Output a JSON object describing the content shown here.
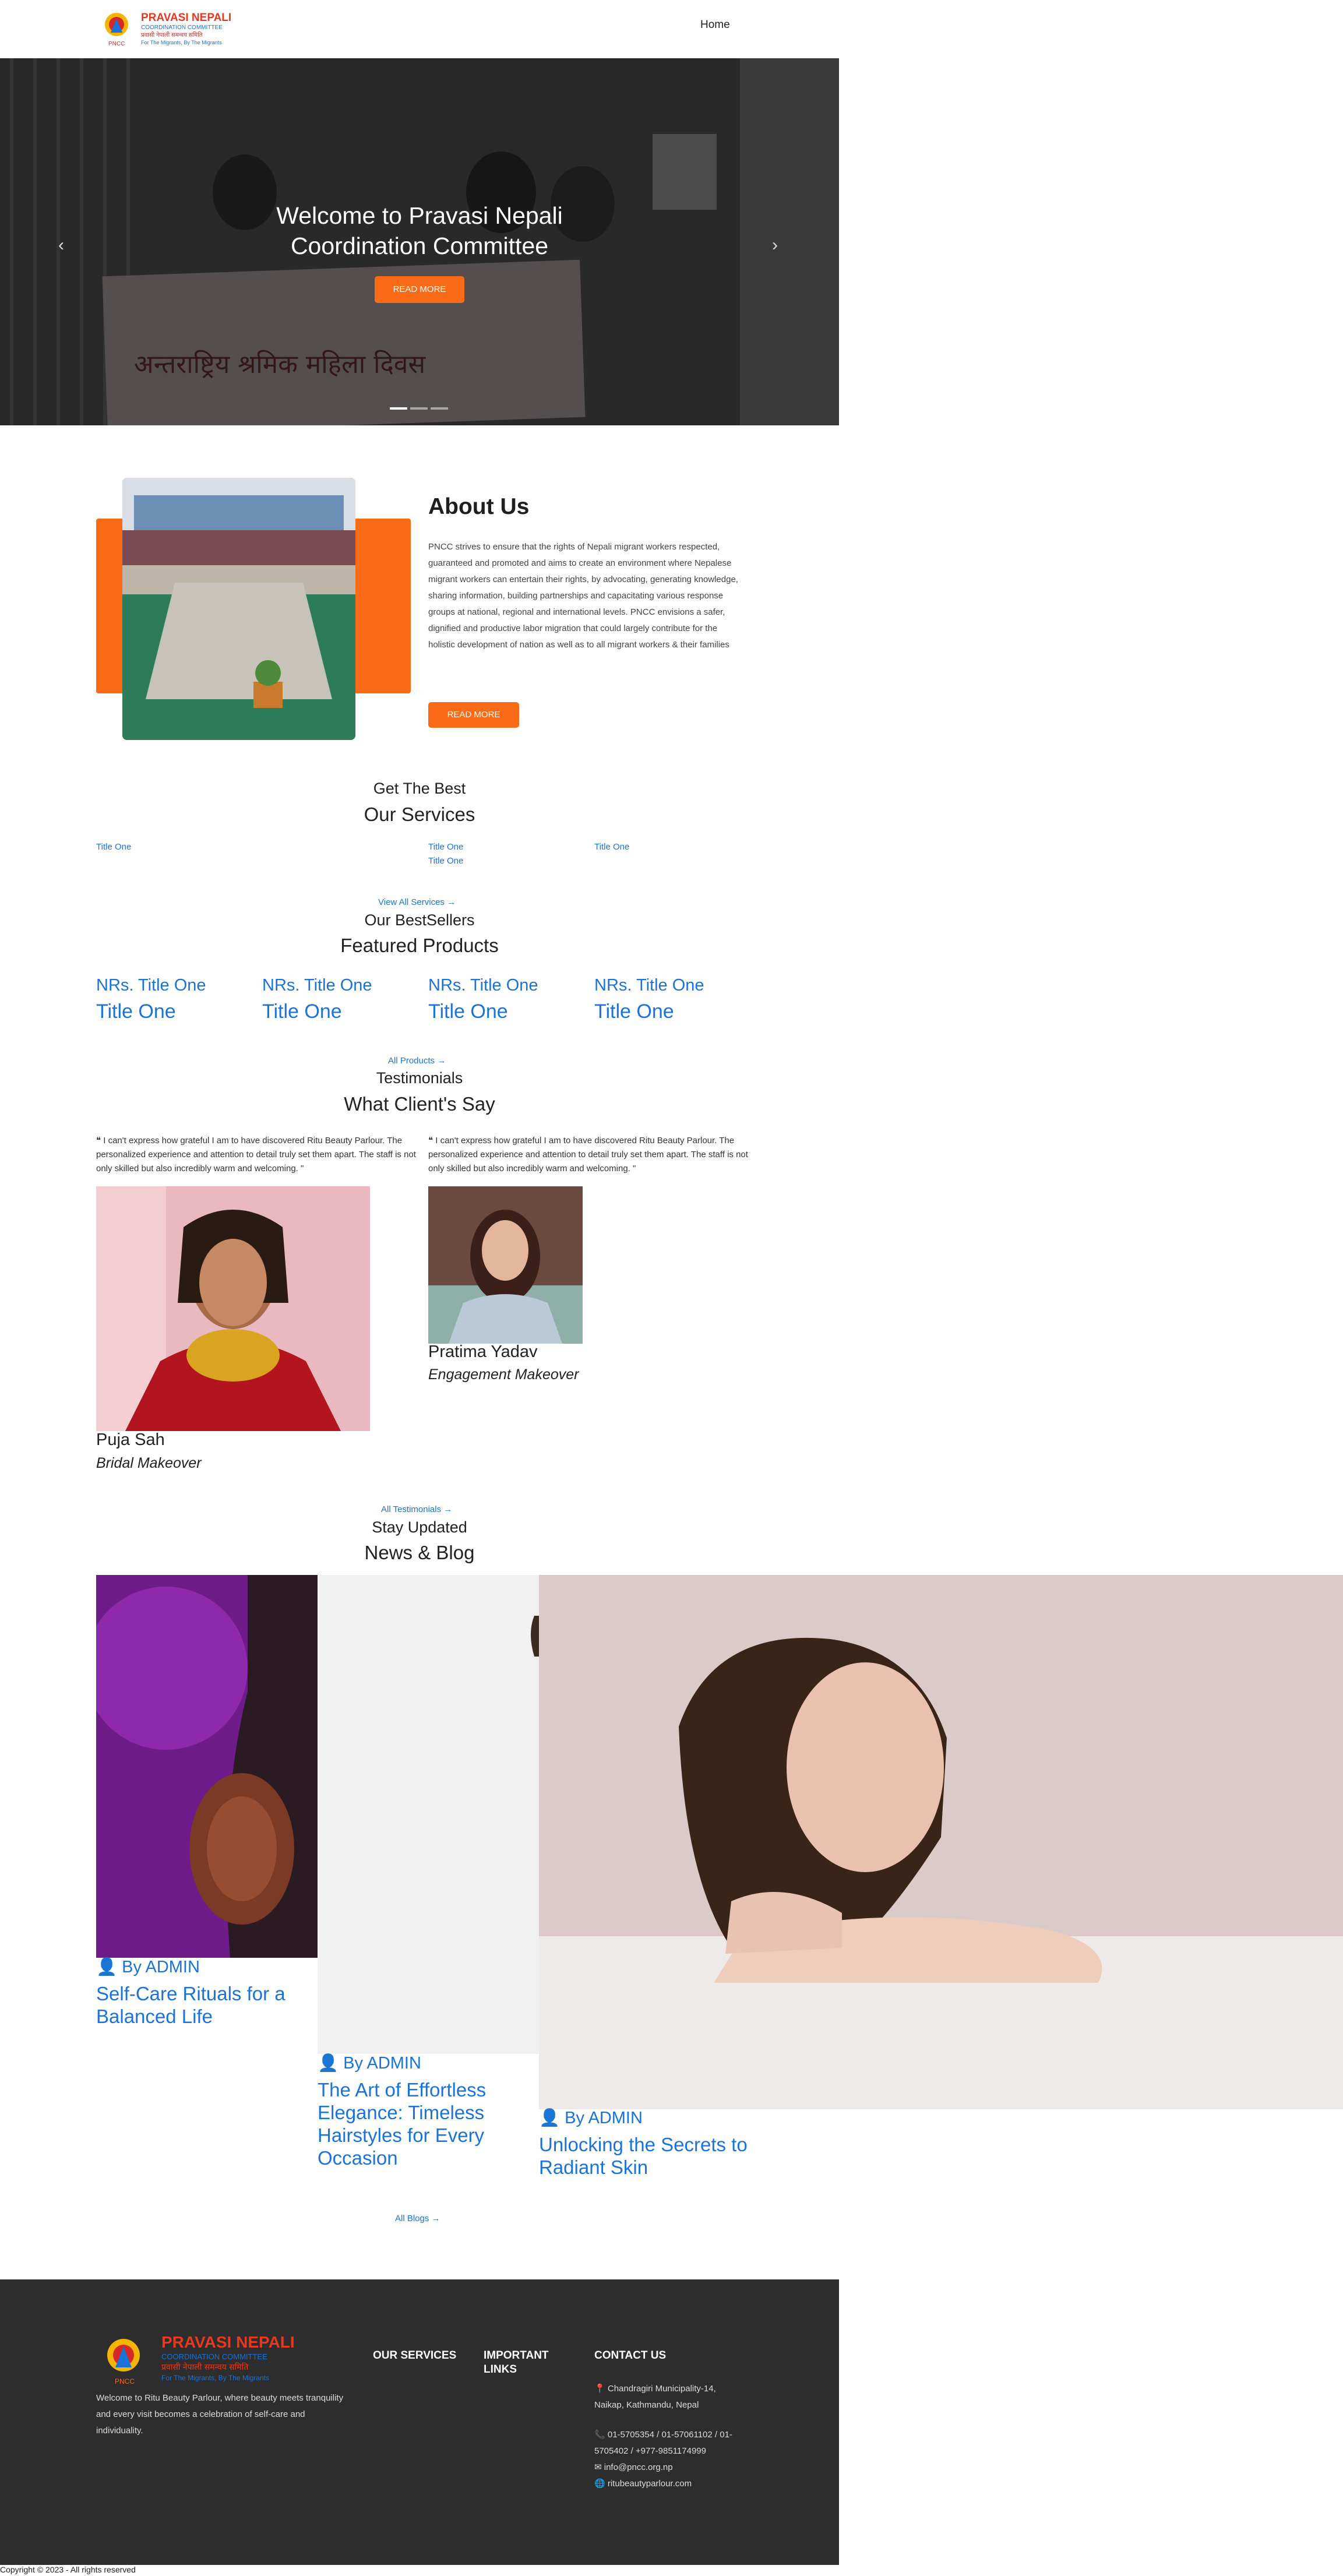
{
  "brand": {
    "name": "PRAVASI NEPALI",
    "tagline": "COORDINATION COMMITTEE",
    "nepali": "प्रवासी नेपाली समन्वय समिति",
    "motto": "For The Migrants, By The Migrants",
    "abbr": "PNCC",
    "colors": {
      "orange": "#f96b16",
      "blue": "#1a73d9",
      "footer": "#2d2d2d"
    }
  },
  "nav": {
    "home": "Home"
  },
  "hero": {
    "title_line1": "Welcome to Pravasi Nepali",
    "title_line2": "Coordination Committee",
    "button": "READ MORE",
    "prev_icon": "chevron-left-icon",
    "next_icon": "chevron-right-icon",
    "banner_text": "अन्तराष्ट्रिय श्रमिक महिला दिवस"
  },
  "about": {
    "title": "About Us",
    "text": "PNCC strives to ensure that the rights of Nepali migrant workers respected, guaranteed and promoted and aims to create an environment where Nepalese migrant workers can entertain their rights, by advocating, generating knowledge, sharing information, building partnerships and capacitating various response groups at national, regional and international levels. PNCC envisions a safer, dignified and productive labor migration that could largely contribute for the holistic development of nation as well as to all migrant workers & their families",
    "button": "READ MORE"
  },
  "services": {
    "subtitle": "Get The Best",
    "title": "Our Services",
    "items": [
      "Title One",
      "Title One",
      "Title One",
      "Title One"
    ],
    "view_all": "View All Services →"
  },
  "products": {
    "subtitle": "Our BestSellers",
    "title": "Featured Products",
    "prices": [
      "NRs. Title One",
      "NRs. Title One",
      "NRs. Title One",
      "NRs. Title One"
    ],
    "names": [
      "Title One",
      "Title One",
      "Title One",
      "Title One"
    ],
    "view_all": "All Products →"
  },
  "testimonials": {
    "subtitle": "Testimonials",
    "title": "What Client's Say",
    "items": [
      {
        "quote": "❝ I can't express how grateful I am to have discovered Ritu Beauty Parlour. The personalized experience and attention to detail truly set them apart. The staff is not only skilled but also incredibly warm and welcoming. \"",
        "name": "Puja Sah",
        "role": "Bridal Makeover"
      },
      {
        "quote": "❝ I can't express how grateful I am to have discovered Ritu Beauty Parlour. The personalized experience and attention to detail truly set them apart. The staff is not only skilled but also incredibly warm and welcoming. \"",
        "name": "Pratima Yadav",
        "role": "Engagement Makeover"
      }
    ],
    "view_all": "All Testimonials →"
  },
  "blog": {
    "subtitle": "Stay Updated",
    "title": "News & Blog",
    "posts": [
      {
        "by": "By ADMIN",
        "title_lines": [
          "Self-Care Rituals for a",
          "Balanced Life"
        ]
      },
      {
        "by": "By ADMIN",
        "title_lines": [
          "The Art of Effortless",
          "Elegance: Timeless",
          "Hairstyles for Every",
          "Occasion"
        ]
      },
      {
        "by": "By ADMIN",
        "title_lines": [
          "Unlocking the Secrets to",
          "Radiant Skin"
        ]
      }
    ],
    "view_all": "All Blogs →"
  },
  "footer": {
    "about": "Welcome to Ritu Beauty Parlour, where beauty meets tranquility and every visit becomes a celebration of self-care and individuality.",
    "services_heading": "OUR SERVICES",
    "links_heading_1": "IMPORTANT",
    "links_heading_2": "LINKS",
    "contact_heading": "CONTACT US",
    "address_1": "Chandragiri Municipality-14,",
    "address_2": "Naikap, Kathmandu, Nepal",
    "phone_1": "01-5705354 / 01-57061102 / 01-",
    "phone_2": "5705402 / +977-9851174999",
    "email": "info@pncc.org.np",
    "website": "ritubeautyparlour.com"
  },
  "copyright": "Copyright © 2023 - All rights reserved"
}
